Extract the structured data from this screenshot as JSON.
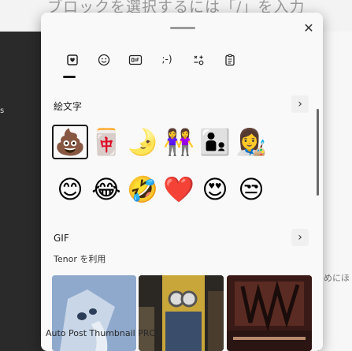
{
  "background": {
    "top_text": "ブロックを選択するには「/」を入力",
    "right_text": "めにほ"
  },
  "panel": {
    "close_icon": "✕",
    "tabs": [
      {
        "name": "emoji-tab",
        "active": true
      },
      {
        "name": "kaomoji-face-tab",
        "active": false
      },
      {
        "name": "gif-tab",
        "active": false
      },
      {
        "name": "text-emoticon-tab",
        "glyph": ";-)",
        "active": false
      },
      {
        "name": "symbols-tab",
        "active": false
      },
      {
        "name": "clipboard-tab",
        "active": false
      }
    ],
    "emoji_section": {
      "label": "絵文字",
      "row1": [
        "💩",
        "🀄",
        "🌛",
        "👭",
        "👨‍👦",
        "👩‍🎨"
      ],
      "row2": [
        "😊",
        "😂",
        "🤣",
        "❤️",
        "😍",
        "😒"
      ]
    },
    "gif_section": {
      "label": "GIF",
      "sub_label": "Tenor を利用"
    },
    "chevron": "›"
  },
  "caption": "Auto Post Thumbnail PRO",
  "colors": {
    "panel_bg": "#f9f9f9",
    "accent": "#1a1a1a"
  }
}
